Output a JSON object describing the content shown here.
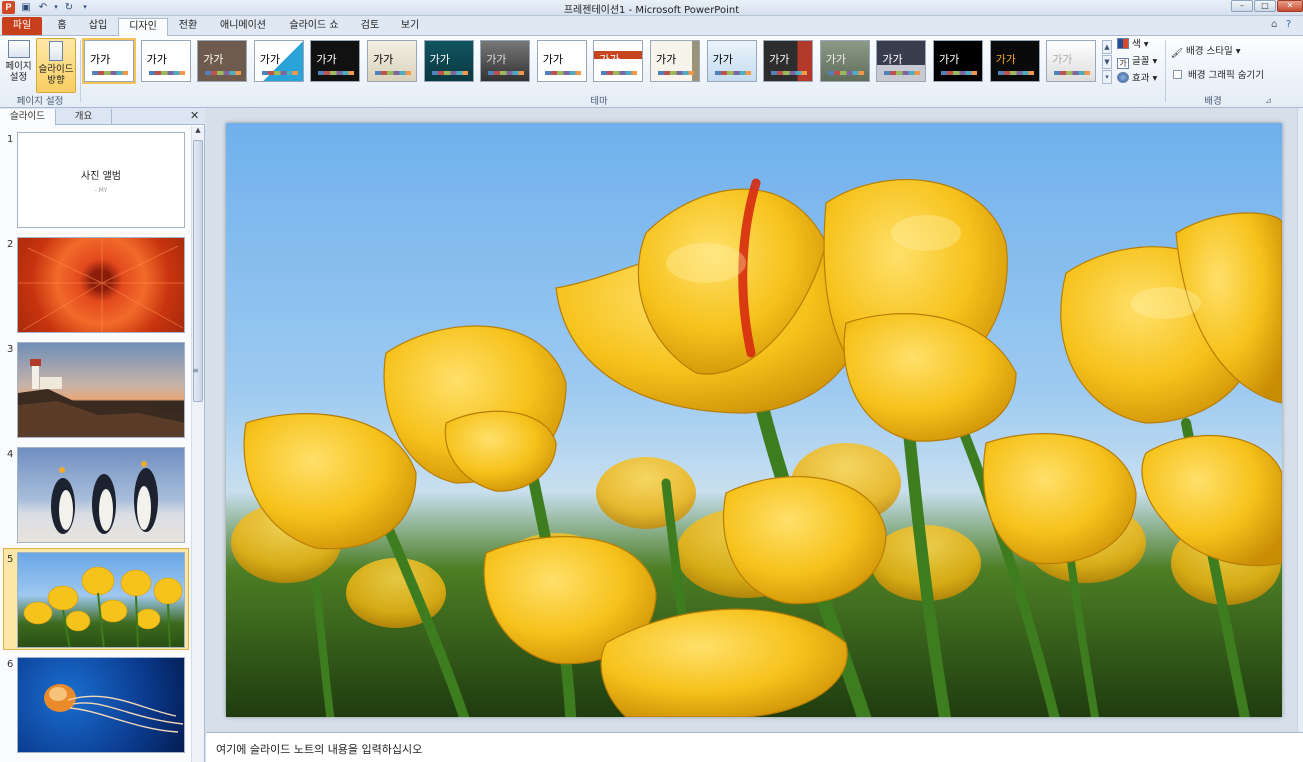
{
  "window": {
    "title": "프레젠테이션1 - Microsoft PowerPoint"
  },
  "tabs": [
    {
      "label": "파일"
    },
    {
      "label": "홈"
    },
    {
      "label": "삽입"
    },
    {
      "label": "디자인"
    },
    {
      "label": "전환"
    },
    {
      "label": "애니메이션"
    },
    {
      "label": "슬라이드 쇼"
    },
    {
      "label": "검토"
    },
    {
      "label": "보기"
    }
  ],
  "ribbon": {
    "page_setup": {
      "button_label": "페이지 설정",
      "orientation_label": "슬라이드 방향",
      "group_label": "페이지 설정"
    },
    "themes": {
      "group_label": "테마",
      "sample_text": "가가",
      "colors_label": "색",
      "fonts_label": "글꼴",
      "effects_label": "효과",
      "fonts_icon_text": "가"
    },
    "background": {
      "styles_label": "배경 스타일",
      "hide_graphics_label": "배경 그래픽 숨기기",
      "group_label": "배경"
    }
  },
  "panel": {
    "tabs": [
      {
        "label": "슬라이드"
      },
      {
        "label": "개요"
      }
    ],
    "slides": [
      {
        "number": "1",
        "title": "사진 앨범",
        "subtitle": "- MY"
      },
      {
        "number": "2",
        "image": "red chrysanthemum"
      },
      {
        "number": "3",
        "image": "lighthouse"
      },
      {
        "number": "4",
        "image": "penguins"
      },
      {
        "number": "5",
        "image": "tulips",
        "selected": true
      },
      {
        "number": "6",
        "image": "jellyfish"
      }
    ]
  },
  "main_slide": {
    "image": "yellow tulips"
  },
  "notes": {
    "placeholder": "여기에 슬라이드 노트의 내용을 입력하십시오"
  },
  "colors": {
    "file_tab": "#c73f1b",
    "selection": "#f3c458",
    "ribbon": "#e4ecf6"
  }
}
